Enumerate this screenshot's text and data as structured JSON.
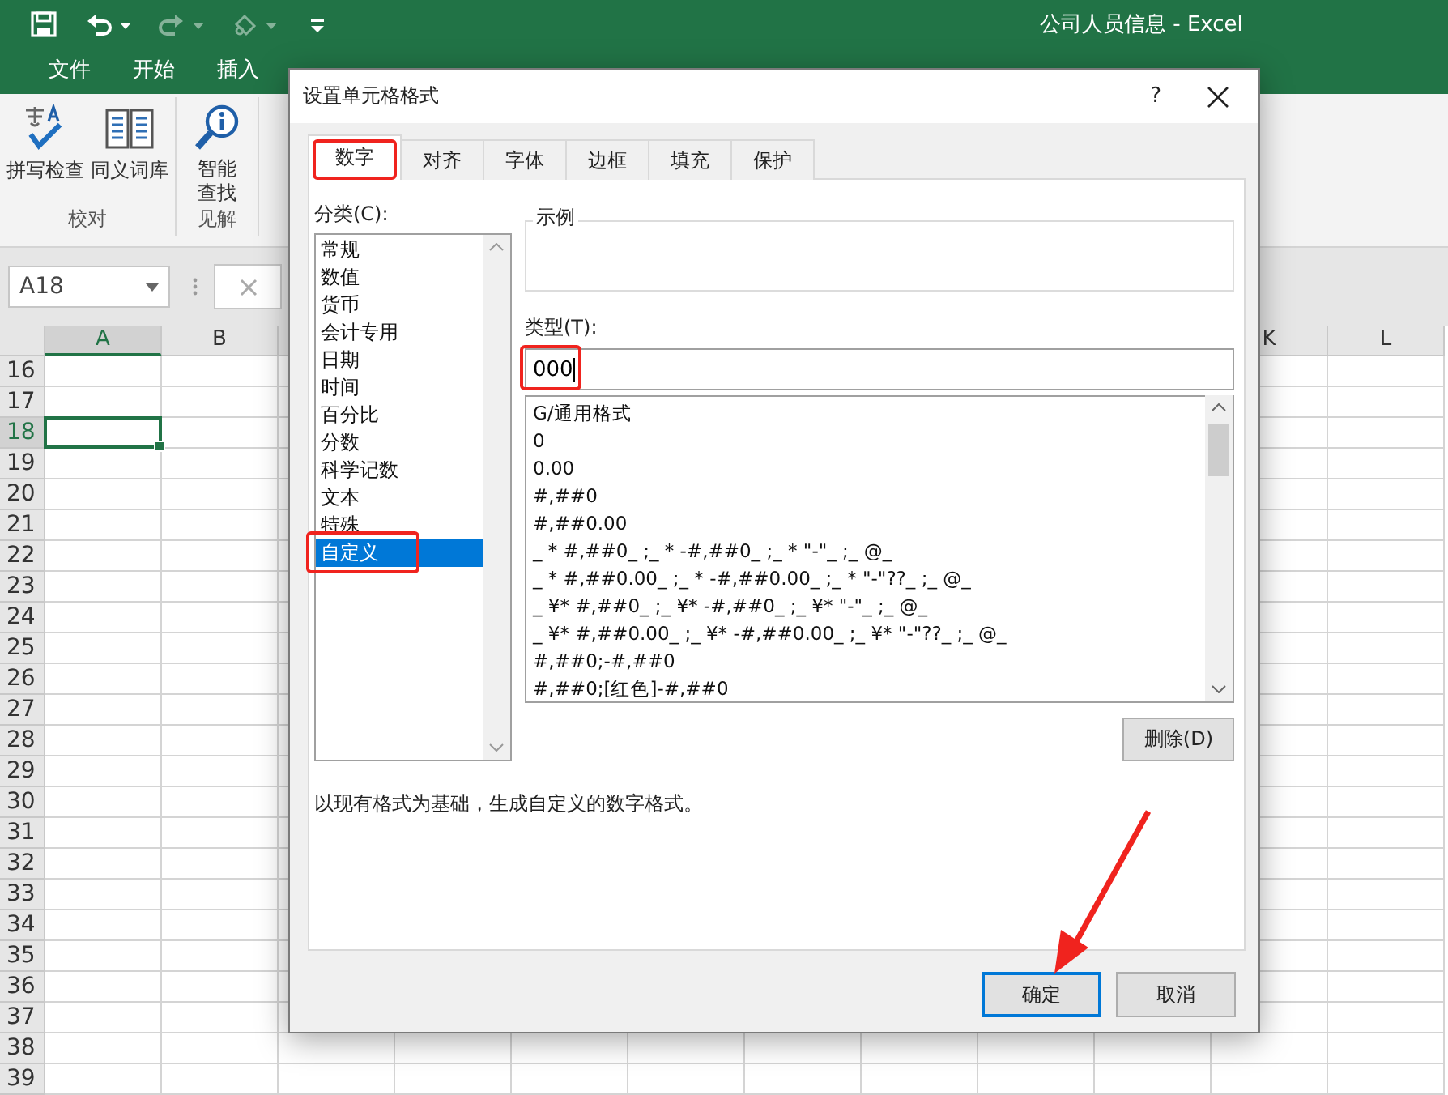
{
  "window": {
    "title": "公司人员信息 - Excel"
  },
  "quick_access": [
    {
      "kind": "save",
      "disabled": false
    },
    {
      "kind": "undo",
      "disabled": false
    },
    {
      "kind": "redo",
      "disabled": true
    },
    {
      "kind": "touch",
      "disabled": true
    },
    {
      "kind": "customize",
      "disabled": false
    }
  ],
  "ribbon_tabs": [
    {
      "label": "文件",
      "selected": false
    },
    {
      "label": "开始",
      "selected": false
    },
    {
      "label": "插入",
      "selected": false
    }
  ],
  "ribbon_groups": [
    {
      "label": "校对",
      "commands": [
        {
          "kind": "spelling",
          "label": "拼写检查"
        },
        {
          "kind": "thesaurus",
          "label": "同义词库"
        }
      ]
    },
    {
      "label": "见解",
      "commands": [
        {
          "kind": "smart_lookup",
          "label": "智能查找"
        }
      ]
    }
  ],
  "name_box": {
    "value": "A18"
  },
  "sheet": {
    "columns_left": [
      {
        "label": "A",
        "selected": true
      },
      {
        "label": "B",
        "selected": false
      }
    ],
    "columns_right": [
      {
        "label": "K",
        "selected": false
      },
      {
        "label": "L",
        "selected": false
      }
    ],
    "rows": [
      {
        "label": "16",
        "selected": false
      },
      {
        "label": "17",
        "selected": false
      },
      {
        "label": "18",
        "selected": true
      },
      {
        "label": "19",
        "selected": false
      },
      {
        "label": "20",
        "selected": false
      },
      {
        "label": "21",
        "selected": false
      },
      {
        "label": "22",
        "selected": false
      },
      {
        "label": "23",
        "selected": false
      },
      {
        "label": "24",
        "selected": false
      },
      {
        "label": "25",
        "selected": false
      },
      {
        "label": "26",
        "selected": false
      },
      {
        "label": "27",
        "selected": false
      },
      {
        "label": "28",
        "selected": false
      },
      {
        "label": "29",
        "selected": false
      },
      {
        "label": "30",
        "selected": false
      },
      {
        "label": "31",
        "selected": false
      },
      {
        "label": "32",
        "selected": false
      },
      {
        "label": "33",
        "selected": false
      },
      {
        "label": "34",
        "selected": false
      },
      {
        "label": "35",
        "selected": false
      },
      {
        "label": "36",
        "selected": false
      },
      {
        "label": "37",
        "selected": false
      },
      {
        "label": "38",
        "selected": false
      },
      {
        "label": "39",
        "selected": false
      }
    ]
  },
  "dialog": {
    "title": "设置单元格格式",
    "help": "?",
    "tabs": [
      {
        "label": "数字",
        "selected": true,
        "annotated": true
      },
      {
        "label": "对齐",
        "selected": false,
        "annotated": false
      },
      {
        "label": "字体",
        "selected": false,
        "annotated": false
      },
      {
        "label": "边框",
        "selected": false,
        "annotated": false
      },
      {
        "label": "填充",
        "selected": false,
        "annotated": false
      },
      {
        "label": "保护",
        "selected": false,
        "annotated": false
      }
    ],
    "category_label": "分类(C):",
    "categories": [
      {
        "label": "常规",
        "selected": false,
        "annotated": false
      },
      {
        "label": "数值",
        "selected": false,
        "annotated": false
      },
      {
        "label": "货币",
        "selected": false,
        "annotated": false
      },
      {
        "label": "会计专用",
        "selected": false,
        "annotated": false
      },
      {
        "label": "日期",
        "selected": false,
        "annotated": false
      },
      {
        "label": "时间",
        "selected": false,
        "annotated": false
      },
      {
        "label": "百分比",
        "selected": false,
        "annotated": false
      },
      {
        "label": "分数",
        "selected": false,
        "annotated": false
      },
      {
        "label": "科学记数",
        "selected": false,
        "annotated": false
      },
      {
        "label": "文本",
        "selected": false,
        "annotated": false
      },
      {
        "label": "特殊",
        "selected": false,
        "annotated": false
      },
      {
        "label": "自定义",
        "selected": true,
        "annotated": true
      }
    ],
    "sample_label": "示例",
    "type_label": "类型(T):",
    "type_field": {
      "value": "000",
      "annotated": true
    },
    "formats": [
      "G/通用格式",
      "0",
      "0.00",
      "#,##0",
      "#,##0.00",
      "_ * #,##0_ ;_ * -#,##0_ ;_ * \"-\"_ ;_ @_",
      "_ * #,##0.00_ ;_ * -#,##0.00_ ;_ * \"-\"??_ ;_ @_",
      "_ ¥* #,##0_ ;_ ¥* -#,##0_ ;_ ¥* \"-\"_ ;_ @_",
      "_ ¥* #,##0.00_ ;_ ¥* -#,##0.00_ ;_ ¥* \"-\"??_ ;_ @_",
      "#,##0;-#,##0",
      "#,##0;[红色]-#,##0"
    ],
    "delete_button": "删除(D)",
    "description": "以现有格式为基础，生成自定义的数字格式。",
    "buttons": [
      {
        "label": "确定",
        "default": true,
        "annotated": true
      },
      {
        "label": "取消",
        "default": false,
        "annotated": false
      }
    ]
  }
}
